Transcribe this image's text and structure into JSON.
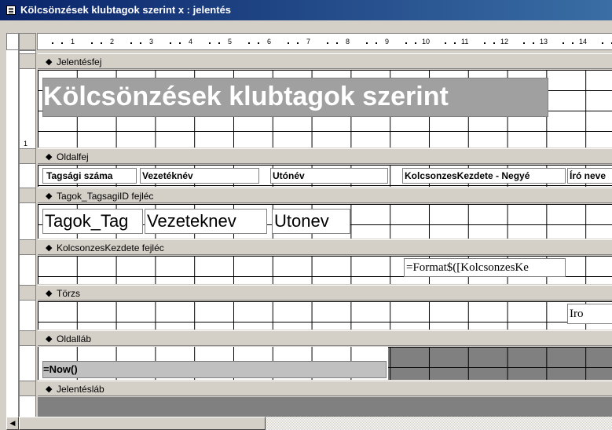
{
  "window": {
    "title": "Kölcsönzések klubtagok szerint x : jelentés"
  },
  "ruler": {
    "numbers": [
      "1",
      "2",
      "3",
      "4",
      "5",
      "6",
      "7",
      "8",
      "9",
      "10",
      "11",
      "12",
      "13",
      "14"
    ],
    "vertical_number": "1"
  },
  "bands": {
    "report_header": "Jelentésfej",
    "page_header": "Oldalfej",
    "group_header_1": "Tagok_TagsagiID fejléc",
    "group_header_2": "KolcsonzesKezdete fejléc",
    "detail": "Törzs",
    "page_footer": "Oldalláb",
    "report_footer": "Jelentésláb"
  },
  "report_header": {
    "title": "Kölcsönzések klubtagok szerint"
  },
  "page_header": {
    "col1": "Tagsági száma",
    "col2": "Vezetéknév",
    "col3": "Utónév",
    "col4": "KolcsonzesKezdete - Negyé",
    "col5": "Író neve"
  },
  "group1": {
    "f1": "Tagok_Tag",
    "f2": "Vezeteknev",
    "f3": "Utonev"
  },
  "group2": {
    "expr": "=Format$([KolcsonzesKe"
  },
  "detail": {
    "iro": "Iro"
  },
  "page_footer": {
    "now": "=Now()"
  },
  "icons": {
    "title_icon": "report-icon",
    "band_icon": "band-arrow-icon"
  }
}
